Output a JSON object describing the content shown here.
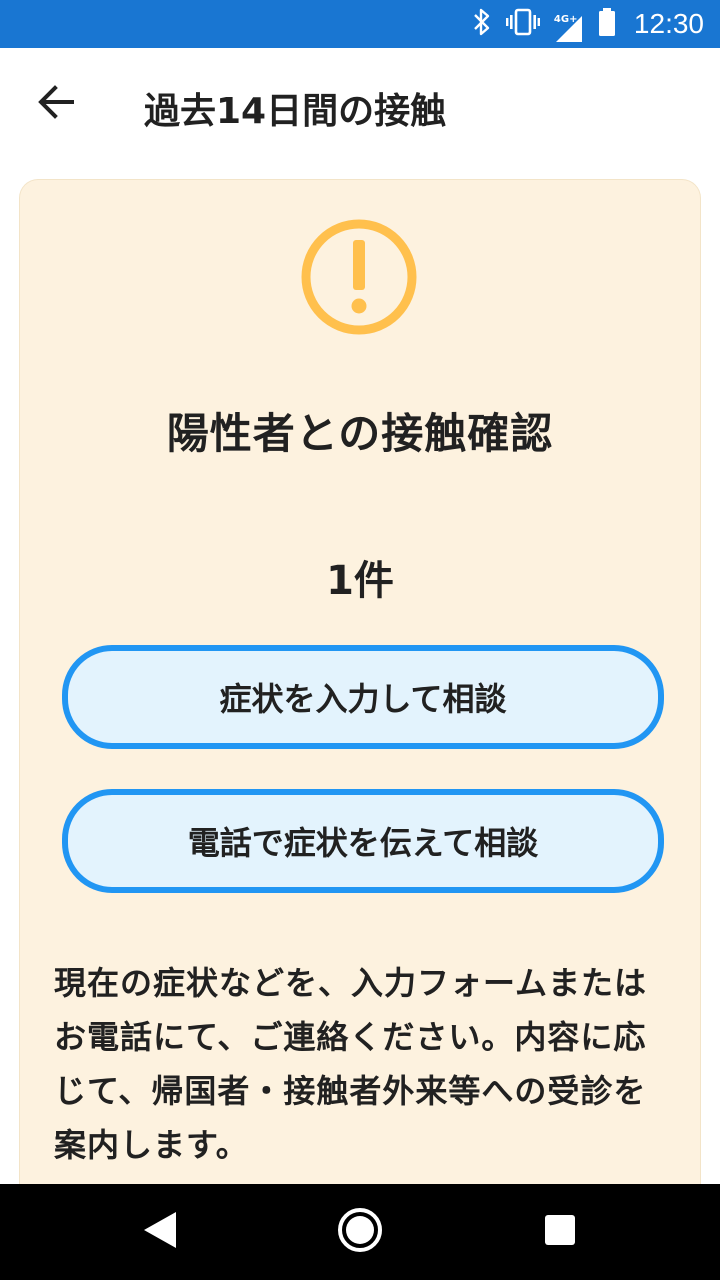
{
  "status_bar": {
    "network_label": "4G+",
    "time": "12:30",
    "icons": [
      "bluetooth-icon",
      "vibrate-icon",
      "signal-icon",
      "battery-icon"
    ]
  },
  "app_bar": {
    "back_icon": "arrow-left-icon",
    "title": "過去14日間の接触"
  },
  "card": {
    "icon": "exclamation-circle-icon",
    "title": "陽性者との接触確認",
    "count": "1件",
    "buttons": [
      {
        "label": "症状を入力して相談"
      },
      {
        "label": "電話で症状を伝えて相談"
      }
    ],
    "description": "現在の症状などを、入力フォームまたはお電話にて、ご連絡ください。内容に応じて、帰国者・接触者外来等への受診を案内します。"
  },
  "nav_bar": {
    "icons": [
      "nav-back-icon",
      "nav-home-icon",
      "nav-recent-icon"
    ]
  },
  "colors": {
    "status_bar": "#1976d2",
    "card_background": "#fdf2df",
    "alert_icon": "#ffc04d",
    "button_border": "#2196f3",
    "button_fill": "#e3f3fd"
  }
}
